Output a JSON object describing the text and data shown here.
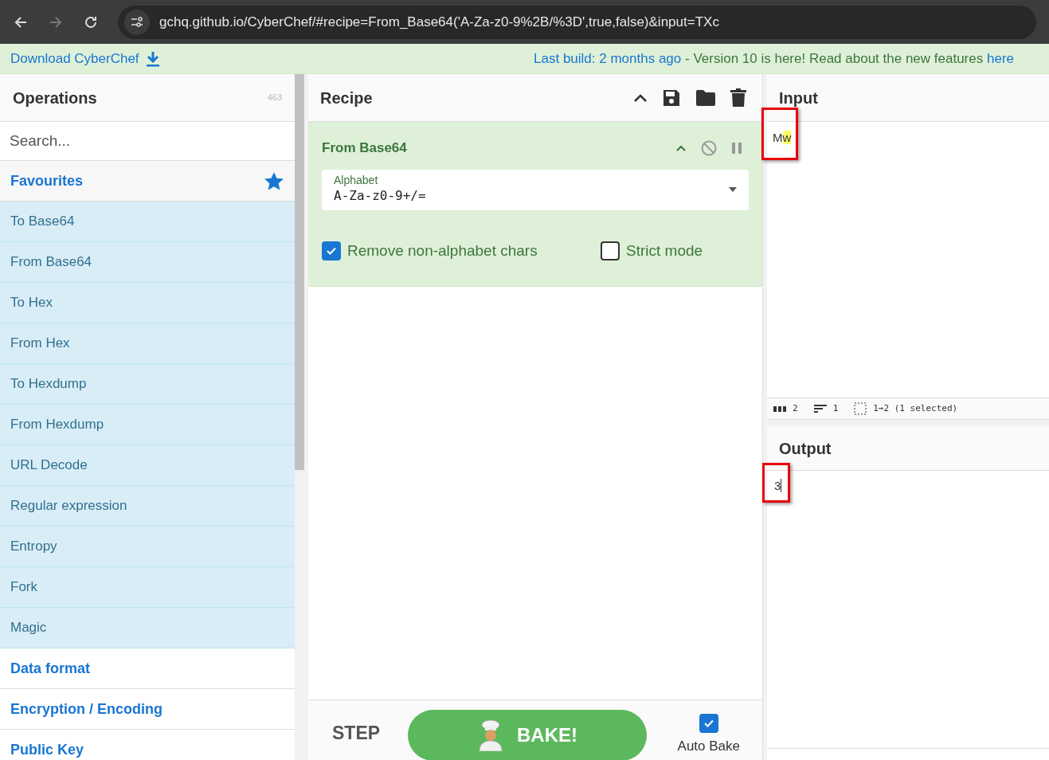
{
  "browser": {
    "url": "gchq.github.io/CyberChef/#recipe=From_Base64('A-Za-z0-9%2B/%3D',true,false)&input=TXc"
  },
  "banner": {
    "download": "Download CyberChef",
    "build_link": "Last build: 2 months ago",
    "message": " - Version 10 is here! Read about the new features ",
    "here_link": "here"
  },
  "operations": {
    "title": "Operations",
    "count": "463",
    "search_placeholder": "Search...",
    "categories": [
      {
        "label": "Favourites",
        "expanded": true,
        "items": [
          "To Base64",
          "From Base64",
          "To Hex",
          "From Hex",
          "To Hexdump",
          "From Hexdump",
          "URL Decode",
          "Regular expression",
          "Entropy",
          "Fork",
          "Magic"
        ]
      },
      {
        "label": "Data format",
        "expanded": false
      },
      {
        "label": "Encryption / Encoding",
        "expanded": false
      },
      {
        "label": "Public Key",
        "expanded": false
      }
    ]
  },
  "recipe": {
    "title": "Recipe",
    "operation": {
      "name": "From Base64",
      "alphabet_label": "Alphabet",
      "alphabet_value": "A-Za-z0-9+/=",
      "options": [
        {
          "label": "Remove non-alphabet chars",
          "checked": true
        },
        {
          "label": "Strict mode",
          "checked": false
        }
      ]
    }
  },
  "controls": {
    "step": "STEP",
    "bake": "BAKE!",
    "auto_bake": {
      "label": "Auto Bake",
      "checked": true
    }
  },
  "input": {
    "title": "Input",
    "text_plain": "M",
    "text_selected": "w",
    "status": {
      "length": "2",
      "lines": "1",
      "selection": "1→2 (1 selected)"
    }
  },
  "output": {
    "title": "Output",
    "text": "3"
  }
}
